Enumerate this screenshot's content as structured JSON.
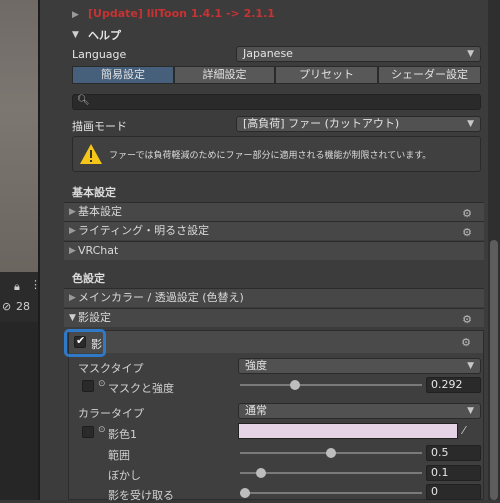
{
  "update_notice": "[Update] lilToon 1.4.1 -> 2.1.1",
  "help": "ヘルプ",
  "language": {
    "label": "Language",
    "value": "Japanese"
  },
  "tabs": [
    {
      "label": "簡易設定"
    },
    {
      "label": "詳細設定"
    },
    {
      "label": "プリセット"
    },
    {
      "label": "シェーダー設定"
    }
  ],
  "render_mode": {
    "label": "描画モード",
    "value": "[高負荷] ファー (カットアウト)"
  },
  "warning": "ファーでは負荷軽減のためにファー部分に適用される機能が制限されています。",
  "basic_group": "基本設定",
  "basic_items": [
    {
      "label": "基本設定"
    },
    {
      "label": "ライティング・明るさ設定"
    },
    {
      "label": "VRChat"
    }
  ],
  "color_group": "色設定",
  "color_items": [
    {
      "label": "メインカラー / 透過設定 (色替え)"
    },
    {
      "label": "影設定"
    }
  ],
  "shadow": {
    "toggle_label": "影",
    "mask_type": {
      "label": "マスクタイプ",
      "value": "強度"
    },
    "mask_strength": {
      "label": "マスクと強度",
      "value": "0.292"
    },
    "color_type": {
      "label": "カラータイプ",
      "value": "通常"
    },
    "shadow_color": {
      "label": "影色1",
      "color": "#e4d4e6"
    },
    "range": {
      "label": "範囲",
      "value": "0.5"
    },
    "blur": {
      "label": "ぼかし",
      "value": "0.1"
    },
    "receive": {
      "label": "影を受け取る",
      "value": "0"
    }
  },
  "scene": {
    "count": "28"
  },
  "colors": {
    "accent_tab": "#46607c",
    "highlight_box": "#2f79c7",
    "warning": "#f5c518"
  }
}
